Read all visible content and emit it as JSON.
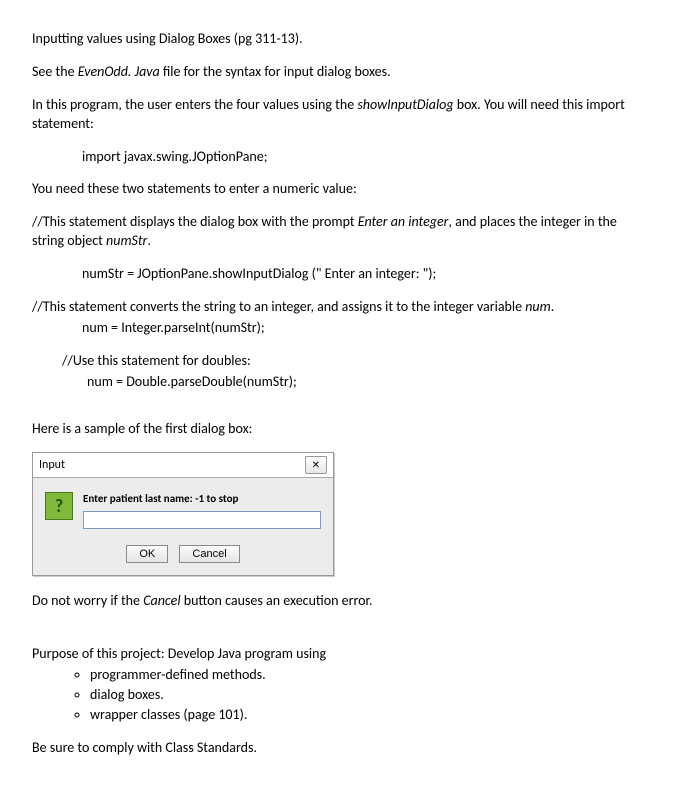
{
  "title_line": "Inputting values using Dialog Boxes (pg 311-13).",
  "see_line_a": "See the ",
  "see_file": "EvenOdd. Java",
  "see_line_b": " file for the syntax for input dialog boxes.",
  "prog_a": "In this program, the user enters the four values using the ",
  "show_input": "showInputDialog",
  "prog_b": " box. You will need this import statement:",
  "import_stmt": "import javax.swing.JOptionPane;",
  "need_two": "You need these two statements to enter a numeric value:",
  "c1a": "//This statement displays the dialog box with the prompt ",
  "c1_prompt": "Enter an integer",
  "c1b": ", and places the integer in the string object ",
  "c1_var": "numStr",
  "c1c": ".",
  "code1": "numStr = JOptionPane.showInputDialog (\"   Enter an integer: \");",
  "c2a": "//This statement converts the string to an integer, and assigns it to the integer variable ",
  "c2_var": "num",
  "c2b": ".",
  "code2": "num = Integer.parseInt(numStr);",
  "c3": "//Use this statement for doubles:",
  "code3": "num = Double.parseDouble(numStr);",
  "sample_heading": "Here is a sample of the first dialog box:",
  "dialog": {
    "title": "Input",
    "close_glyph": "✕",
    "question_glyph": "?",
    "prompt": "Enter patient last name: -1 to stop",
    "ok": "OK",
    "cancel": "Cancel"
  },
  "do_not_a": "Do not worry if the ",
  "do_not_cancel": "Cancel",
  "do_not_b": " button causes an execution error.",
  "purpose_heading": "Purpose of this project: Develop Java program using",
  "purpose_items": [
    "programmer-defined methods.",
    "dialog boxes.",
    "wrapper classes (page 101)."
  ],
  "comply": "Be sure to comply with Class Standards."
}
